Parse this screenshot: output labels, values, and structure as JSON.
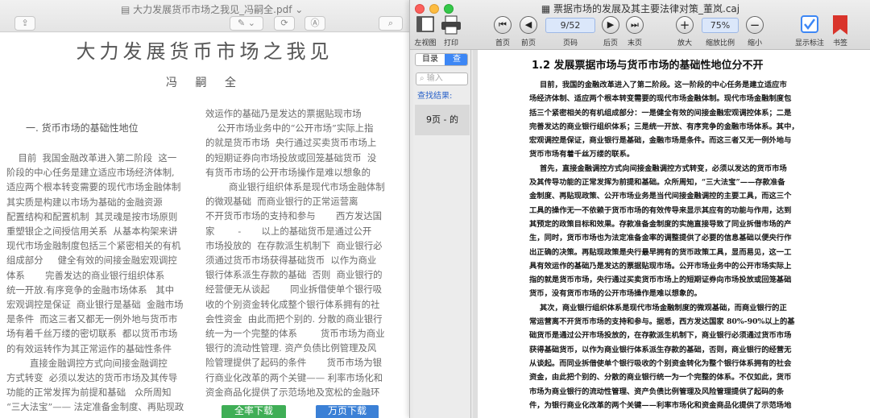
{
  "left_window": {
    "title": "大力发展货币市场之我见_冯嗣全.pdf",
    "toolbar": {
      "share": "⇪",
      "pen": "✎",
      "chevron": "⌄",
      "rotate": "⟳",
      "annot": "Ⓐ",
      "search": "⌕"
    },
    "doc_title": "大力发展货币市场之我见",
    "author": "冯 嗣 全",
    "section1": "一. 货币市场的基础性地位",
    "col1_lines": [
      "    目前  我国金融改革进入第二阶段  这一",
      "阶段的中心任务是建立适应市场经济体制,",
      "适应两个根本转变需要的现代市场金融体制",
      "其实质是构建以市场为基础的金融资源",
      "配置结构和配置机制  其灵魂是按市场原则",
      "重塑银企之间授信用关系  从基本构架来讲",
      "现代市场金融制度包括三个紧密相关的有机",
      "组成部分     健全有效的间接金融宏观调控",
      "体系       完善发达的商业银行组织体系",
      "统一开放.有序竞争的金融市场体系   其中",
      "宏观调控是保证  商业银行是基础  金融市场",
      "是条件  而这三者又都无一例外地与货币市",
      "场有着千丝万缕的密切联系  都以货币市场",
      "的有效运转作为其正常运作的基础性条件",
      "        直接金融调控方式向间接金融调控",
      "方式转变  必须以发达的货币市场及其传导",
      "功能的正常发挥为前提和基础   众所周知",
      "“三大法宝”—— 法定准备金制度、再贴现政"
    ],
    "col2_lines": [
      "效运作的基础乃是发达的票据贴现市场",
      "    公开市场业务中的“公开市场”实际上指",
      "的就是货币市场  央行通过买卖货币市场上",
      "的短期证券向市场投放或回笼基础货币  没",
      "有货币市场的公开市场操作是难以想象的",
      "        商业银行组织体系是现代市场金融体制",
      "的微观基础  而商业银行的正常运营离",
      "不开货币市场的支持和参与       西方发达国",
      "家        -       以上的基础货币是通过公开",
      "市场投放的  在存款派生机制下  商业银行必",
      "须通过货币市场获得基础货币  以作为商业",
      "银行体系派生存款的基础  否则  商业银行的",
      "经营便无从谈起       同业拆借使单个银行吸",
      "收的个别资金转化成整个银行体系拥有的社",
      "会性资金  由此而把个别的. 分散的商业银行",
      "统一为一个完整的体系        货币市场为商业",
      "银行的流动性管理. 资产负债比例管理及风",
      "险管理提供了起码的条件       货币市场为银",
      "行商业化改革的两个关键—— 利率市场化和",
      "资金商品化提供了示范场地及宽松的金融环"
    ],
    "buttons": {
      "green": "全率下载",
      "blue": "万页下载"
    }
  },
  "right_window": {
    "title": "票据市场的发展及其主要法律对策_董岚.caj",
    "toolbar": [
      {
        "name": "sidebar",
        "label": "左视图"
      },
      {
        "name": "print",
        "label": "打印"
      },
      {
        "name": "first",
        "label": "首页"
      },
      {
        "name": "prev",
        "label": "前页"
      },
      {
        "name": "pageno",
        "label": "页码",
        "value": "9/52"
      },
      {
        "name": "next",
        "label": "后页"
      },
      {
        "name": "last",
        "label": "末页"
      },
      {
        "name": "zoom-in",
        "label": "放大"
      },
      {
        "name": "zoom",
        "label": "缩放比例",
        "value": "75%"
      },
      {
        "name": "zoom-out",
        "label": "缩小"
      },
      {
        "name": "annot",
        "label": "显示标注"
      },
      {
        "name": "bookmark",
        "label": "书签"
      }
    ],
    "sidebar": {
      "tab_toc": "目录",
      "tab_search": "查",
      "search_placeholder": "输入",
      "results_label": "查找结果:",
      "result_item": "9页 - 的"
    },
    "heading": "1.2  发展票据市场与货币市场的基础性地位分不开",
    "body_lines": [
      "    目前，我国的金融改革进入了第二阶段。这一阶段的中心任务是建立适应市",
      "场经济体制、适应两个根本转变需要的现代市场金融体制。现代市场金融制度包",
      "括三个紧密相关的有机组成部分：一是健全有效的间接金融宏观调控体系；二是",
      "完善发达的商业银行组织体系；三是统一开放、有序竞争的金融市场体系。其中，",
      "宏观调控是保证，商业银行是基础，金融市场是条件。而这三者又无一例外地与",
      "货币市场有着千丝万缕的联系。",
      "    首先，直接金融调控方式向间接金融调控方式转变，必须以发达的货币市场",
      "及其传导功能的正常发挥为前提和基础。众所周知，“三大法宝”——存款准备",
      "金制度、再贴现政策、公开市场业务是当代间接金融调控的主要工具，而这三个",
      "工具的操作无一不依赖于货币市场的有效传导来显示其应有的功能与作用，达到",
      "其预定的政策目标和效果。存款准备金制度的实施直接导致了同业拆借市场的产",
      "生，同时，货币市场也为法定准备金率的调整提供了必要的信息基础以便央行作",
      "出正确的决策。再贴现政策是央行最早拥有的货币政策工具，显而易见，这一工",
      "具有效运作的基础乃是发达的票据贴现市场。公开市场业务中的公开市场实际上",
      "指的就是货币市场，央行通过买卖货币市场上的短期证券向市场投放或回笼基础",
      "货币，没有货币市场的公开市场操作是难以想象的。",
      "    其次，商业银行组织体系是现代市场金融制度的微观基础，而商业银行的正",
      "常运营离不开货币市场的支持和参与。据悉，西方发达国家 80%-90%以上的基",
      "础货币是通过公开市场投放的，在存款派生机制下，商业银行必须通过货币市场",
      "获得基础货币，以作为商业银行体系派生存款的基础，否则，商业银行的经营无",
      "从谈起。而同业拆借使单个银行吸收的个别资金转化为整个银行体系拥有的社会",
      "资金，由此把个别的、分散的商业银行统一为一个完整的体系。不仅如此，货币",
      "市场为商业银行的流动性管理、资产负债比例管理及风险管理提供了起码的条",
      "件，为银行商业化改革的两个关键——利率市场化和资金商品化提供了示范场地"
    ]
  }
}
